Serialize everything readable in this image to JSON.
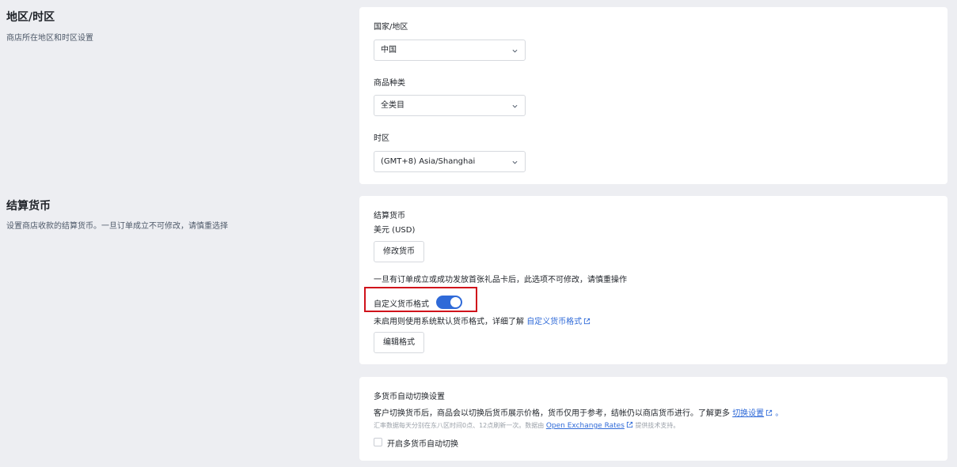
{
  "region": {
    "title": "地区/时区",
    "description": "商店所在地区和时区设置",
    "country_label": "国家/地区",
    "country_value": "中国",
    "category_label": "商品种类",
    "category_value": "全类目",
    "timezone_label": "时区",
    "timezone_value": "(GMT+8) Asia/Shanghai"
  },
  "currency": {
    "title": "结算货币",
    "description": "设置商店收款的结算货币。一旦订单成立不可修改，请慎重选择",
    "field_label": "结算货币",
    "field_value": "美元 (USD)",
    "change_button": "修改货币",
    "warning": "一旦有订单成立或成功发放首张礼品卡后，此选项不可修改，请慎重操作",
    "custom_format_label": "自定义货币格式",
    "custom_format_enabled": true,
    "custom_format_hint": "未启用则使用系统默认货币格式，详细了解",
    "custom_format_link": "自定义货币格式",
    "edit_format_button": "编辑格式"
  },
  "multi_currency": {
    "title": "多货币自动切换设置",
    "description": "客户切换货币后，商品会以切换后货币展示价格，货币仅用于参考，结帐仍以商店货币进行。了解更多",
    "settings_link": "切换设置",
    "trailing": "。",
    "note_prefix": "汇率数据每天分别在东八区时间0点、12点刷新一次。数据由",
    "note_link": "Open Exchange Rates",
    "note_suffix": "提供技术支持。",
    "checkbox_label": "开启多货币自动切换",
    "checkbox_checked": false
  },
  "colors": {
    "accent": "#2f6ad8",
    "highlight": "#d0121b",
    "background": "#edeef2"
  }
}
